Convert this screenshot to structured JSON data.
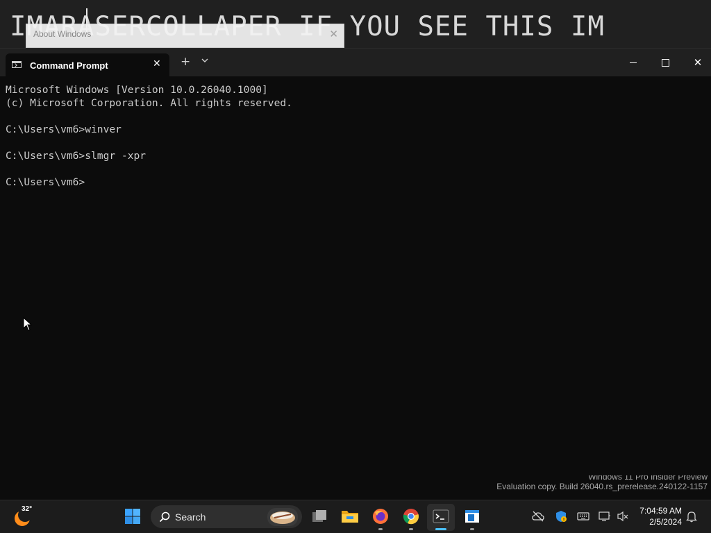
{
  "desktop": {
    "banner_text": "IMARASERCOLLAPER IF YOU SEE THIS IM"
  },
  "about_dialog": {
    "title": "About Windows",
    "close_glyph": "✕"
  },
  "terminal": {
    "tab_title": "Command Prompt",
    "tab_icon": "cmd-icon",
    "tab_close_glyph": "✕",
    "new_tab_glyph": "+",
    "dropdown_glyph": "⌄",
    "close_glyph": "✕",
    "lines": [
      "Microsoft Windows [Version 10.0.26040.1000]",
      "(c) Microsoft Corporation. All rights reserved.",
      "",
      "C:\\Users\\vm6>winver",
      "",
      "C:\\Users\\vm6>slmgr -xpr",
      "",
      "C:\\Users\\vm6>"
    ]
  },
  "watermark": {
    "line1": "Windows 11 Pro Insider Preview",
    "line2": "Evaluation copy. Build 26040.rs_prerelease.240122-1157"
  },
  "taskbar": {
    "weather_temp": "32°",
    "search_label": "Search",
    "pinned": [
      "start-icon",
      "task-view-icon",
      "file-explorer-icon",
      "firefox-icon",
      "chrome-icon",
      "terminal-icon",
      "notepad-icon"
    ],
    "tray": [
      "cloud-off-icon",
      "defender-icon",
      "keyboard-icon",
      "network-icon",
      "volume-muted-icon"
    ],
    "time": "7:04:59 AM",
    "date": "2/5/2024",
    "colors": {
      "accent": "#4cc2ff",
      "taskbar": "#1c1c1c"
    }
  }
}
